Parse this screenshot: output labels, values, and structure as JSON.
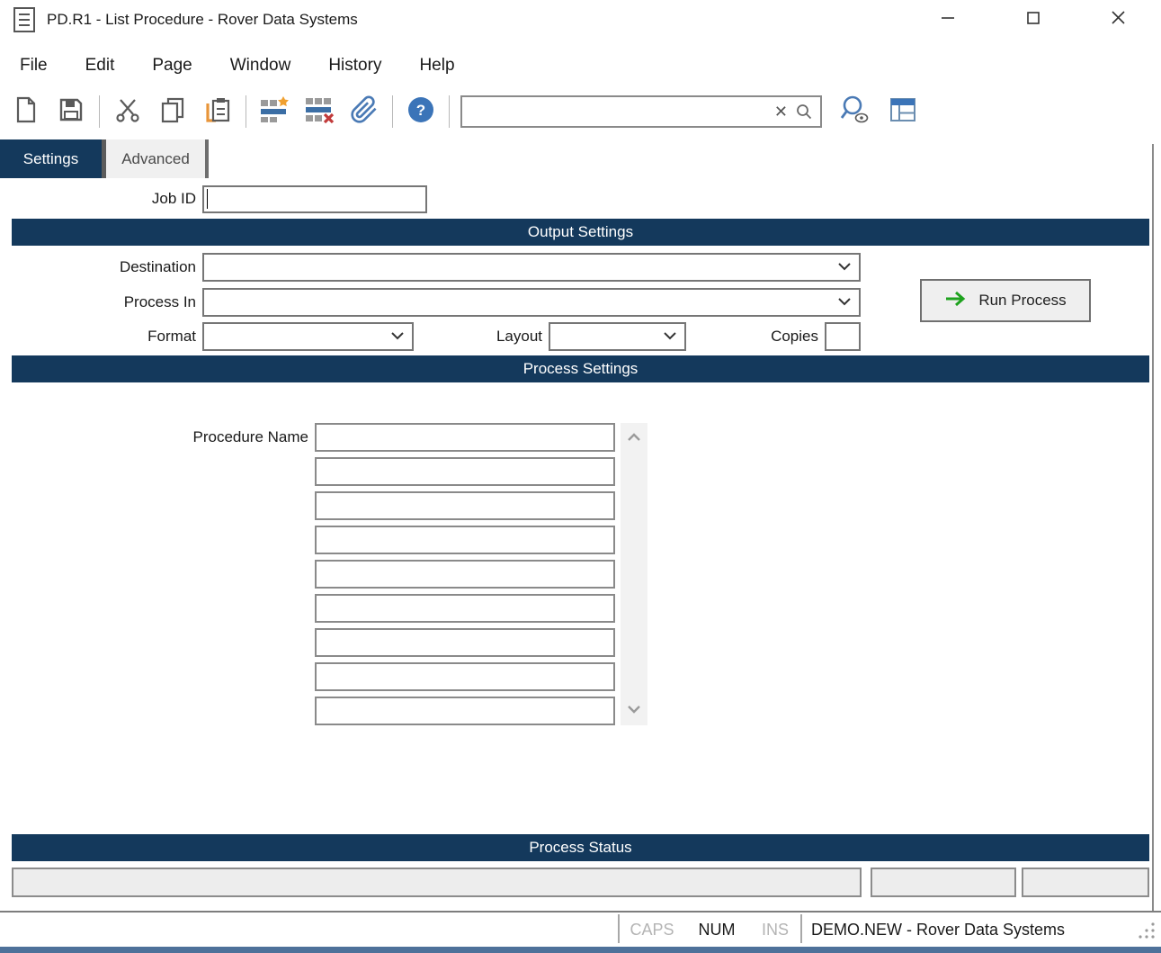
{
  "window": {
    "title": "PD.R1 - List Procedure - Rover Data Systems"
  },
  "menu": {
    "items": [
      "File",
      "Edit",
      "Page",
      "Window",
      "History",
      "Help"
    ]
  },
  "toolbar": {
    "search_value": "",
    "search_placeholder": ""
  },
  "tabs": {
    "settings": "Settings",
    "advanced": "Advanced"
  },
  "form": {
    "job_id_label": "Job ID",
    "job_id_value": "",
    "output_settings_header": "Output Settings",
    "destination_label": "Destination",
    "destination_value": "",
    "process_in_label": "Process In",
    "process_in_value": "",
    "run_process_label": "Run Process",
    "format_label": "Format",
    "format_value": "",
    "layout_label": "Layout",
    "layout_value": "",
    "copies_label": "Copies",
    "copies_value": "",
    "process_settings_header": "Process Settings",
    "procedure_name_label": "Procedure Name",
    "procedure_rows": [
      "",
      "",
      "",
      "",
      "",
      "",
      "",
      "",
      ""
    ],
    "process_status_header": "Process Status",
    "status_values": [
      "",
      "",
      ""
    ]
  },
  "statusbar": {
    "caps": "CAPS",
    "num": "NUM",
    "ins": "INS",
    "session": "DEMO.NEW - Rover Data Systems"
  },
  "icons": {
    "app": "document-lines",
    "minimize": "—",
    "maximize": "□",
    "close": "✕",
    "new_document": "blank-page",
    "save": "floppy-disk",
    "cut": "scissors",
    "copy": "two-pages",
    "paste": "clipboard-orange-bracket",
    "insert_row": "grid-row-add-star",
    "delete_row": "grid-row-delete-x",
    "attachment": "paperclip",
    "help": "?",
    "clear_search": "×",
    "search": "magnifier",
    "record_search": "magnifier-eye",
    "layout": "panel-layout",
    "run_arrow": "→",
    "dropdown": "⌄",
    "scroll_up": "⌃",
    "scroll_down": "⌄"
  },
  "colors": {
    "header_navy": "#14395c",
    "accent_blue": "#3b6ea5",
    "accent_orange": "#f0a030",
    "accent_red": "#c23b3b",
    "accent_green": "#1ea21e",
    "bottombar_blue": "#4e719a"
  }
}
